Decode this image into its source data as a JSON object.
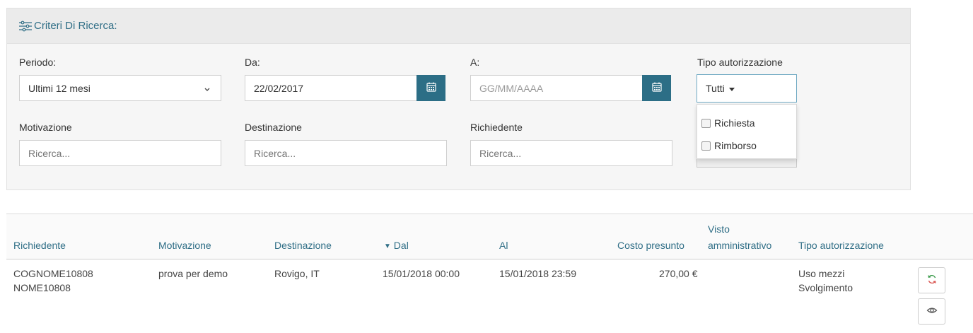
{
  "criteria": {
    "title": "Criteri Di Ricerca:",
    "icon": "sliders-icon",
    "periodo_label": "Periodo:",
    "periodo_value": "Ultimi 12 mesi",
    "da_label": "Da:",
    "da_value": "22/02/2017",
    "a_label": "A:",
    "a_placeholder": "GG/MM/AAAA",
    "tipo_label": "Tipo autorizzazione",
    "tipo_value": "Tutti",
    "tipo_options": [
      "Richiesta",
      "Rimborso"
    ],
    "motivazione_label": "Motivazione",
    "motivazione_placeholder": "Ricerca...",
    "destinazione_label": "Destinazione",
    "destinazione_placeholder": "Ricerca...",
    "richiedente_label": "Richiedente",
    "richiedente_placeholder": "Ricerca..."
  },
  "table": {
    "headers": {
      "richiedente": "Richiedente",
      "motivazione": "Motivazione",
      "destinazione": "Destinazione",
      "dal": "Dal",
      "dal_sort": "▼",
      "al": "Al",
      "costo": "Costo presunto",
      "visto_line1": "Visto",
      "visto_line2": "amministrativo",
      "tipo": "Tipo autorizzazione"
    },
    "rows": [
      {
        "richiedente_line1": "COGNOME10808",
        "richiedente_line2": "NOME10808",
        "motivazione": "prova per demo",
        "destinazione": "Rovigo, IT",
        "dal": "15/01/2018 00:00",
        "al": "15/01/2018 23:59",
        "costo": "270,00 €",
        "tipo_line1": "Uso mezzi",
        "tipo_line2": "Svolgimento"
      }
    ]
  },
  "colors": {
    "accent": "#2c6e86",
    "link": "#2f6e86"
  }
}
